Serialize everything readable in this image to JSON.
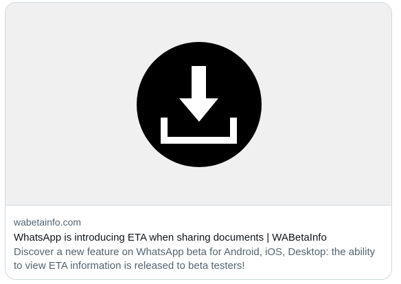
{
  "card": {
    "domain": "wabetainfo.com",
    "title": "WhatsApp is introducing ETA when sharing documents | WABetaInfo",
    "description": "Discover a new feature on WhatsApp beta for Android, iOS, Desktop: the ability to view ETA information is released to beta testers!"
  },
  "media": {
    "icon": "download-icon",
    "background_color": "#f0f0f0",
    "icon_color": "#000000"
  }
}
